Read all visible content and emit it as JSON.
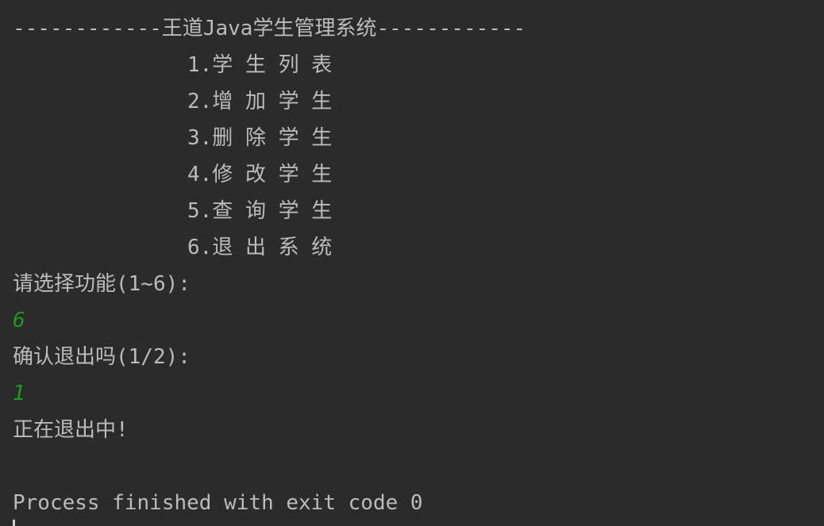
{
  "console": {
    "header": "------------王道Java学生管理系统------------",
    "menu": [
      "1.学 生 列 表",
      "2.增 加 学 生",
      "3.删 除 学 生",
      "4.修 改 学 生",
      "5.查 询 学 生",
      "6.退 出 系 统"
    ],
    "prompt_choose": "请选择功能(1~6):",
    "input_choose": "6",
    "prompt_confirm": "确认退出吗(1/2):",
    "input_confirm": "1",
    "exiting": "正在退出中!",
    "blank": "",
    "process_finished": "Process finished with exit code 0"
  },
  "colors": {
    "background": "#2b2b2b",
    "text": "#bbbbbb",
    "user_input": "#1f9a1f"
  }
}
